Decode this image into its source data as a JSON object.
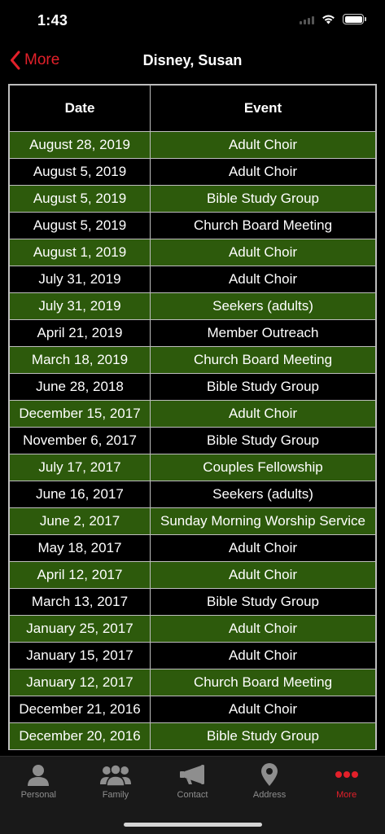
{
  "status": {
    "time": "1:43"
  },
  "nav": {
    "back_label": "More",
    "title": "Disney, Susan"
  },
  "table": {
    "headers": [
      "Date",
      "Event"
    ],
    "rows": [
      {
        "date": "August 28, 2019",
        "event": "Adult Choir"
      },
      {
        "date": "August 5, 2019",
        "event": "Adult Choir"
      },
      {
        "date": "August 5, 2019",
        "event": "Bible Study Group"
      },
      {
        "date": "August 5, 2019",
        "event": "Church Board Meeting"
      },
      {
        "date": "August 1, 2019",
        "event": "Adult Choir"
      },
      {
        "date": "July 31, 2019",
        "event": "Adult Choir"
      },
      {
        "date": "July 31, 2019",
        "event": "Seekers (adults)"
      },
      {
        "date": "April 21, 2019",
        "event": "Member Outreach"
      },
      {
        "date": "March 18, 2019",
        "event": "Church Board Meeting"
      },
      {
        "date": "June 28, 2018",
        "event": "Bible Study Group"
      },
      {
        "date": "December 15, 2017",
        "event": "Adult Choir"
      },
      {
        "date": "November 6, 2017",
        "event": "Bible Study Group"
      },
      {
        "date": "July 17, 2017",
        "event": "Couples Fellowship"
      },
      {
        "date": "June 16, 2017",
        "event": "Seekers (adults)"
      },
      {
        "date": "June 2, 2017",
        "event": "Sunday Morning Worship Service"
      },
      {
        "date": "May 18, 2017",
        "event": "Adult Choir"
      },
      {
        "date": "April 12, 2017",
        "event": "Adult Choir"
      },
      {
        "date": "March 13, 2017",
        "event": "Bible Study Group"
      },
      {
        "date": "January 25, 2017",
        "event": "Adult Choir"
      },
      {
        "date": "January 15, 2017",
        "event": "Adult Choir"
      },
      {
        "date": "January 12, 2017",
        "event": "Church Board Meeting"
      },
      {
        "date": "December 21, 2016",
        "event": "Adult Choir"
      },
      {
        "date": "December 20, 2016",
        "event": "Bible Study Group"
      }
    ]
  },
  "tabs": [
    {
      "label": "Personal",
      "icon": "person-icon"
    },
    {
      "label": "Family",
      "icon": "family-icon"
    },
    {
      "label": "Contact",
      "icon": "megaphone-icon"
    },
    {
      "label": "Address",
      "icon": "location-pin-icon"
    },
    {
      "label": "More",
      "icon": "more-dots-icon",
      "active": true
    }
  ],
  "colors": {
    "accent": "#e3202a",
    "row_green": "#2d5a0c",
    "background": "#000000",
    "tab_inactive": "#8e8e8e"
  }
}
